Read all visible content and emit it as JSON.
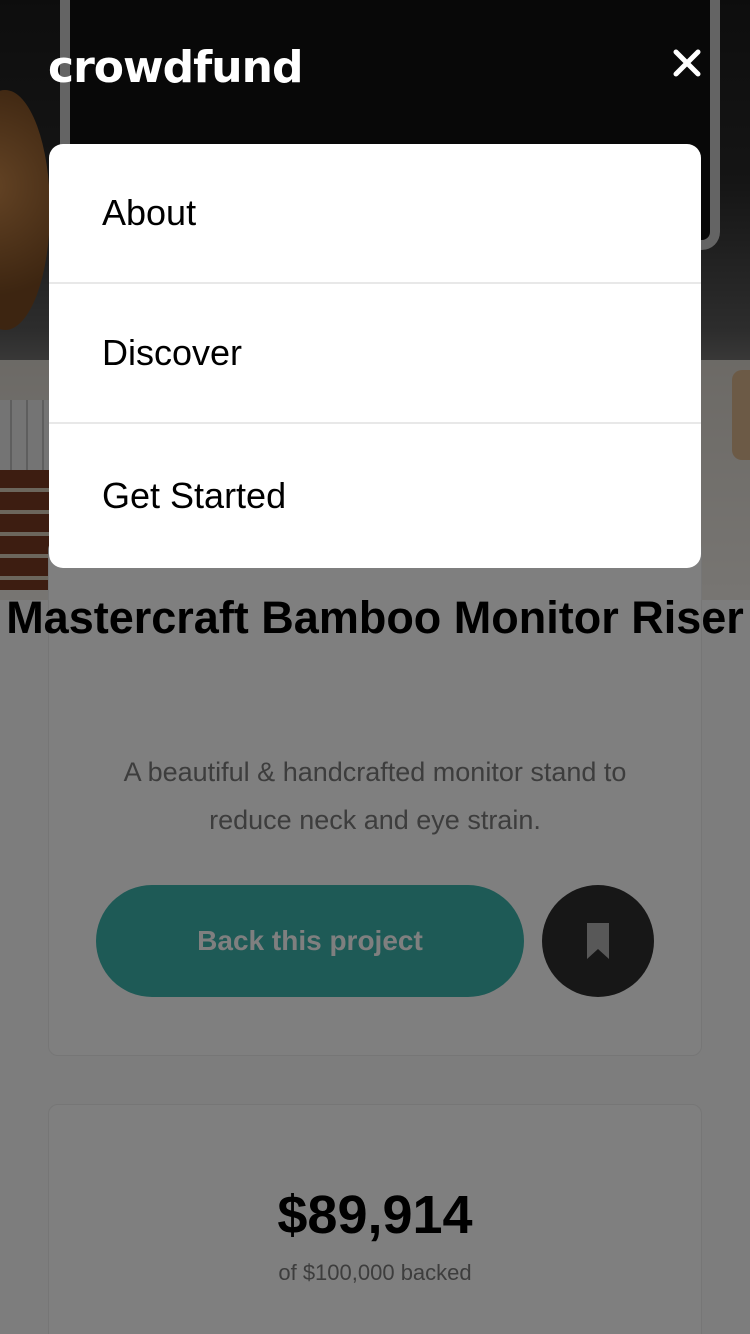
{
  "header": {
    "logo": "crowdfund",
    "close_icon": "close-icon"
  },
  "menu": {
    "items": [
      {
        "label": "About"
      },
      {
        "label": "Discover"
      },
      {
        "label": "Get Started"
      }
    ]
  },
  "product": {
    "title": "Mastercraft Bamboo Monitor Riser",
    "description": "A beautiful & handcrafted monitor stand to reduce neck and eye strain.",
    "back_button_label": "Back this project",
    "bookmark_icon": "bookmark-icon"
  },
  "stats": {
    "amount": "$89,914",
    "amount_sub": "of $100,000 backed"
  },
  "colors": {
    "accent": "#3cb4ac",
    "dark": "#2f2f2f",
    "overlay": "rgba(0,0,0,0.5)"
  }
}
